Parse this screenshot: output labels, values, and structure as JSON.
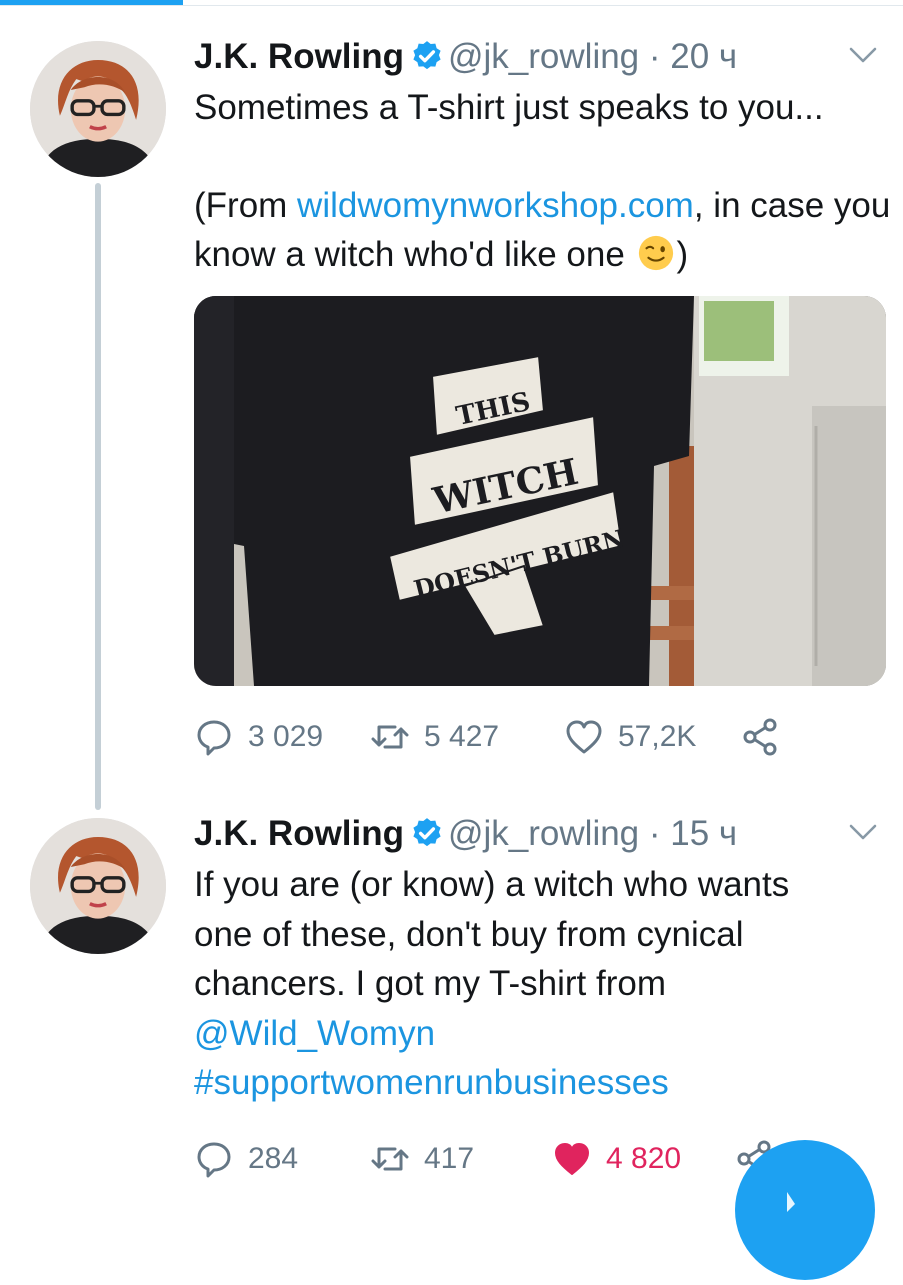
{
  "theme": {
    "accent": "#1da1f2",
    "link": "#1b95e0",
    "muted": "#657786",
    "like": "#e0245e"
  },
  "tweets": [
    {
      "author": {
        "name": "J.K. Rowling",
        "handle": "@jk_rowling",
        "verified": true
      },
      "separator": "·",
      "time": "20 ч",
      "text": {
        "line1": "Sometimes a T-shirt just speaks to you...",
        "line2_prefix": "(From ",
        "link": "wildwomynworkshop.com",
        "line2_suffix": ", in case you know a witch who'd like one ",
        "emoji": "winking-face-emoji",
        "line2_end": ")"
      },
      "media": {
        "type": "photo",
        "shirt_text": [
          "THIS",
          "WITCH",
          "DOESN'T BURN"
        ]
      },
      "stats": {
        "replies": "3 029",
        "retweets": "5 427",
        "likes": "57,2K",
        "liked": false
      }
    },
    {
      "author": {
        "name": "J.K. Rowling",
        "handle": "@jk_rowling",
        "verified": true
      },
      "separator": "·",
      "time": "15 ч",
      "text": {
        "body": "If you are (or know) a witch who wants one of these, don't buy from cynical chancers. I got my T-shirt from",
        "mention": "@Wild_Womyn",
        "hashtag": "#supportwomenrunbusinesses"
      },
      "stats": {
        "replies": "284",
        "retweets": "417",
        "likes": "4 820",
        "liked": true
      }
    }
  ],
  "icons": {
    "reply": "reply-icon",
    "retweet": "retweet-icon",
    "like": "heart-icon",
    "share": "share-icon",
    "more": "chevron-down-icon",
    "compose": "compose-tweet-icon"
  }
}
